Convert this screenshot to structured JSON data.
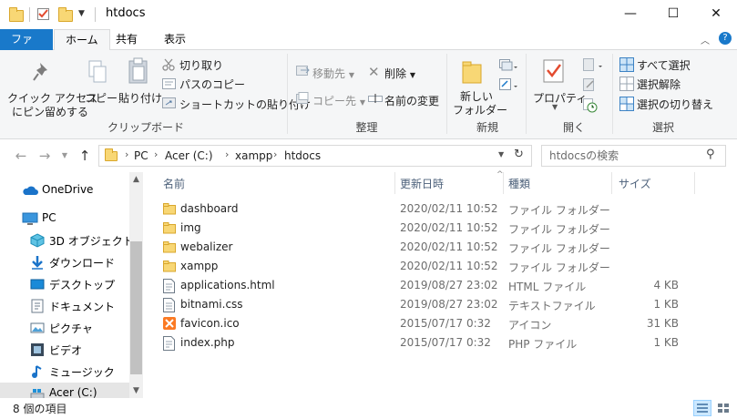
{
  "window": {
    "title": "htdocs",
    "minimize_glyph": "—",
    "maximize_glyph": "☐",
    "close_glyph": "✕"
  },
  "ribbon_tabs": [
    {
      "label": "ファイル"
    },
    {
      "label": "ホーム"
    },
    {
      "label": "共有"
    },
    {
      "label": "表示"
    }
  ],
  "ribbon": {
    "clipboard": {
      "pin_label_1": "クイック アクセス",
      "pin_label_2": "にピン留めする",
      "copy_label": "コピー",
      "paste_label": "貼り付け",
      "cut_label": "切り取り",
      "copy_path_label": "パスのコピー",
      "paste_shortcut_label": "ショートカットの貼り付け",
      "group_label": "クリップボード"
    },
    "organize": {
      "move_to_label": "移動先",
      "copy_to_label": "コピー先",
      "delete_label": "削除",
      "rename_label": "名前の変更",
      "group_label": "整理"
    },
    "new": {
      "new_folder_label_1": "新しい",
      "new_folder_label_2": "フォルダー",
      "group_label": "新規"
    },
    "open": {
      "properties_label": "プロパティ",
      "group_label": "開く"
    },
    "select": {
      "select_all_label": "すべて選択",
      "select_none_label": "選択解除",
      "invert_label": "選択の切り替え",
      "group_label": "選択"
    }
  },
  "address": {
    "crumbs": [
      "PC",
      "Acer (C:)",
      "xampp",
      "htdocs"
    ],
    "search_placeholder": "htdocsの検索"
  },
  "sidebar": {
    "items": [
      {
        "label": "OneDrive",
        "icon": "onedrive-icon"
      },
      {
        "label": "PC",
        "icon": "pc-icon"
      },
      {
        "label": "3D オブジェクト",
        "icon": "3d-objects-icon"
      },
      {
        "label": "ダウンロード",
        "icon": "download-icon"
      },
      {
        "label": "デスクトップ",
        "icon": "desktop-icon"
      },
      {
        "label": "ドキュメント",
        "icon": "documents-icon"
      },
      {
        "label": "ピクチャ",
        "icon": "pictures-icon"
      },
      {
        "label": "ビデオ",
        "icon": "videos-icon"
      },
      {
        "label": "ミュージック",
        "icon": "music-icon"
      },
      {
        "label": "Acer (C:)",
        "icon": "drive-icon"
      }
    ]
  },
  "file_list": {
    "columns": {
      "name": "名前",
      "date": "更新日時",
      "type": "種類",
      "size": "サイズ"
    },
    "rows": [
      {
        "name": "dashboard",
        "date": "2020/02/11 10:52",
        "type": "ファイル フォルダー",
        "size": "",
        "icon": "folder-icon"
      },
      {
        "name": "img",
        "date": "2020/02/11 10:52",
        "type": "ファイル フォルダー",
        "size": "",
        "icon": "folder-icon"
      },
      {
        "name": "webalizer",
        "date": "2020/02/11 10:52",
        "type": "ファイル フォルダー",
        "size": "",
        "icon": "folder-icon"
      },
      {
        "name": "xampp",
        "date": "2020/02/11 10:52",
        "type": "ファイル フォルダー",
        "size": "",
        "icon": "folder-icon"
      },
      {
        "name": "applications.html",
        "date": "2019/08/27 23:02",
        "type": "HTML ファイル",
        "size": "4 KB",
        "icon": "html-file-icon"
      },
      {
        "name": "bitnami.css",
        "date": "2019/08/27 23:02",
        "type": "テキストファイル",
        "size": "1 KB",
        "icon": "text-file-icon"
      },
      {
        "name": "favicon.ico",
        "date": "2015/07/17 0:32",
        "type": "アイコン",
        "size": "31 KB",
        "icon": "xampp-icon"
      },
      {
        "name": "index.php",
        "date": "2015/07/17 0:32",
        "type": "PHP ファイル",
        "size": "1 KB",
        "icon": "php-file-icon"
      }
    ]
  },
  "status": {
    "item_count": "8 個の項目"
  },
  "colors": {
    "accent": "#1979ca",
    "folder": "#f8d775",
    "xampp": "#fb7a24"
  }
}
